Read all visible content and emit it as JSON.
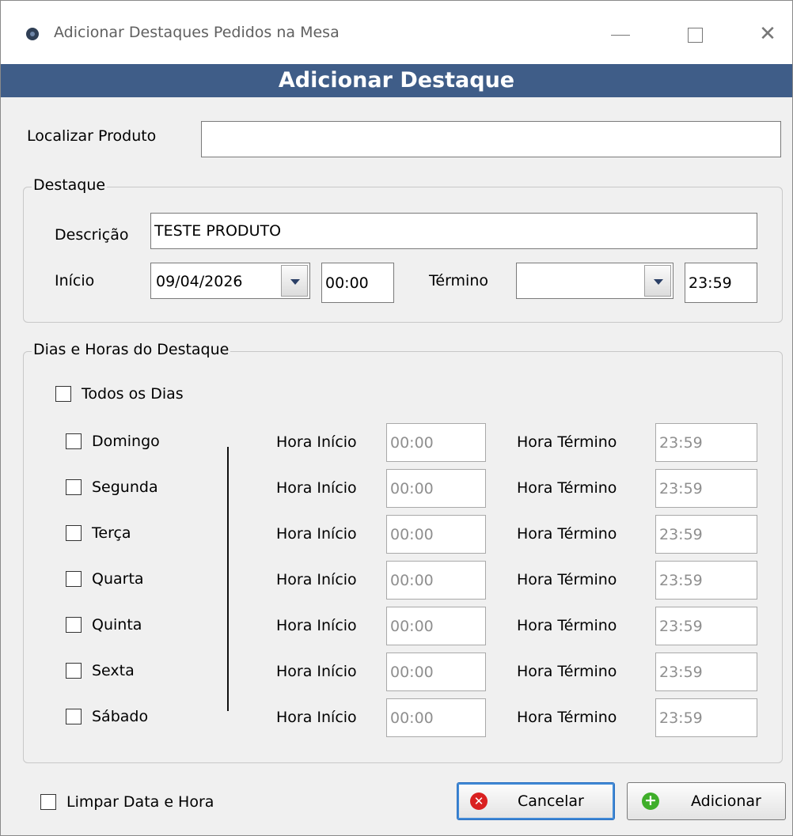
{
  "window": {
    "title": "Adicionar Destaques Pedidos na Mesa",
    "controls": {
      "minimize": "—",
      "maximize": "☐",
      "close": "✕"
    }
  },
  "banner": {
    "title": "Adicionar Destaque"
  },
  "search": {
    "label": "Localizar Produto",
    "value": ""
  },
  "destaque": {
    "group_title": "Destaque",
    "descricao_label": "Descrição",
    "descricao_value": "TESTE PRODUTO",
    "inicio_label": "Início",
    "inicio_date": "09/04/2026",
    "inicio_time": "00:00",
    "termino_label": "Término",
    "termino_date": "",
    "termino_time": "23:59"
  },
  "schedule": {
    "group_title": "Dias e Horas do Destaque",
    "todos_label": "Todos os Dias",
    "todos_checked": false,
    "hora_inicio_label": "Hora Início",
    "hora_termino_label": "Hora Término",
    "days": [
      {
        "name": "Domingo",
        "checked": false,
        "start": "00:00",
        "end": "23:59"
      },
      {
        "name": "Segunda",
        "checked": false,
        "start": "00:00",
        "end": "23:59"
      },
      {
        "name": "Terça",
        "checked": false,
        "start": "00:00",
        "end": "23:59"
      },
      {
        "name": "Quarta",
        "checked": false,
        "start": "00:00",
        "end": "23:59"
      },
      {
        "name": "Quinta",
        "checked": false,
        "start": "00:00",
        "end": "23:59"
      },
      {
        "name": "Sexta",
        "checked": false,
        "start": "00:00",
        "end": "23:59"
      },
      {
        "name": "Sábado",
        "checked": false,
        "start": "00:00",
        "end": "23:59"
      }
    ]
  },
  "footer": {
    "limpar_label": "Limpar Data e Hora",
    "limpar_checked": false,
    "cancel_label": "Cancelar",
    "add_label": "Adicionar"
  },
  "colors": {
    "banner": "#3f5d88",
    "cancel_icon": "#d92020",
    "add_icon": "#3fae2a"
  }
}
